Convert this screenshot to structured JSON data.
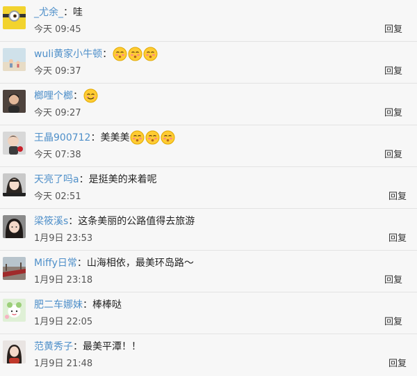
{
  "comments": [
    {
      "name": "_尤余_",
      "sep": "：",
      "text": "哇",
      "emojis": [],
      "time": "今天 09:45",
      "reply": "回复",
      "avatar_icon": "minion-avatar",
      "avatar_color": "#f2d32e"
    },
    {
      "name": "wuli黄家小牛顿",
      "sep": "：",
      "text": "",
      "emojis": [
        "blushing-face-emoji",
        "blushing-face-emoji",
        "blushing-face-emoji"
      ],
      "time": "今天 09:37",
      "reply": "回复",
      "avatar_icon": "beach-scene-avatar",
      "avatar_color": "#cfe1ea"
    },
    {
      "name": "榔哩个榔",
      "sep": "：",
      "text": "",
      "emojis": [
        "smiling-face-emoji"
      ],
      "time": "今天 09:27",
      "reply": "回复",
      "avatar_icon": "person-photo-avatar",
      "avatar_color": "#6b5a50"
    },
    {
      "name": "王晶900712",
      "sep": "：",
      "text": "美美美",
      "emojis": [
        "blushing-face-emoji",
        "blushing-face-emoji",
        "blushing-face-emoji"
      ],
      "time": "今天 07:38",
      "reply": "回复",
      "avatar_icon": "child-photo-avatar",
      "avatar_color": "#d8d8d8"
    },
    {
      "name": "天亮了吗a",
      "sep": "：",
      "text": "是挺美的来着呢",
      "emojis": [],
      "time": "今天 02:51",
      "reply": "回复",
      "avatar_icon": "girl-photo-avatar",
      "avatar_color": "#c9c9c9"
    },
    {
      "name": "梁筱溪s",
      "sep": "：",
      "text": "这条美丽的公路值得去旅游",
      "emojis": [],
      "time": "1月9日 23:53",
      "reply": "回复",
      "avatar_icon": "girl-photo-avatar",
      "avatar_color": "#8a8a8a"
    },
    {
      "name": "Miffy日常",
      "sep": "：",
      "text": "山海相依，最美环岛路～",
      "emojis": [],
      "time": "1月9日 23:18",
      "reply": "回复",
      "avatar_icon": "road-scene-avatar",
      "avatar_color": "#b0a29a"
    },
    {
      "name": "肥二车娜妹",
      "sep": "：",
      "text": "棒棒哒",
      "emojis": [],
      "time": "1月9日 22:05",
      "reply": "回复",
      "avatar_icon": "cartoon-avatar",
      "avatar_color": "#dff0d6"
    },
    {
      "name": "范黄秀子",
      "sep": "：",
      "text": "最美平潭！！",
      "emojis": [],
      "time": "1月9日 21:48",
      "reply": "回复",
      "avatar_icon": "woman-photo-avatar",
      "avatar_color": "#e9e4e2"
    }
  ]
}
